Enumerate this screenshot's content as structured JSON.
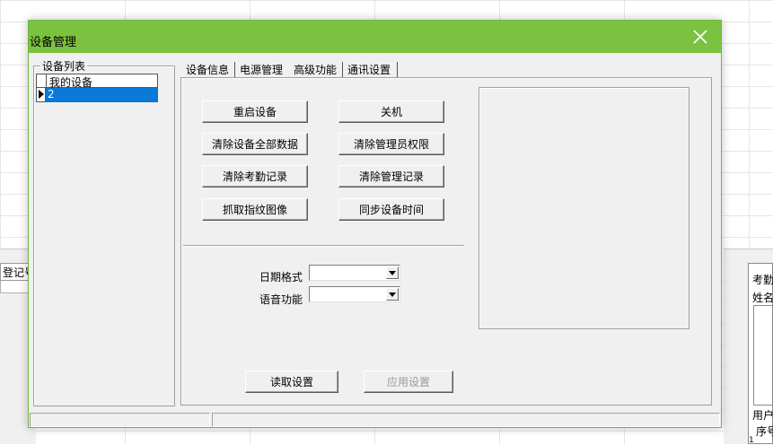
{
  "background": {
    "left_field_text": "登记号",
    "right_texts": [
      "考勤",
      "姓名",
      "用户",
      "序号"
    ],
    "right_number": "1"
  },
  "dialog": {
    "title": "设备管理",
    "close_icon": "close-x-icon",
    "titlebar_color": "#7cc241"
  },
  "device_list": {
    "group_title": "设备列表",
    "header": "我的设备",
    "selected_row": "2",
    "row_indicator_icon": "row-pointer-icon"
  },
  "tabs": [
    "设备信息",
    "电源管理",
    "高级功能",
    "通讯设置"
  ],
  "active_tab": "高级功能",
  "buttons": {
    "restart": "重启设备",
    "shutdown": "关机",
    "clear_all": "清除设备全部数据",
    "clear_admin_rights": "清除管理员权限",
    "clear_attendance": "清除考勤记录",
    "clear_admin_records": "清除管理记录",
    "capture_fingerprint": "抓取指纹图像",
    "sync_time": "同步设备时间",
    "read_settings": "读取设置",
    "apply_settings": "应用设置"
  },
  "settings": {
    "date_format_label": "日期格式",
    "date_format_value": "",
    "voice_label": "语音功能",
    "voice_value": ""
  },
  "selection_color": "#0a78d7"
}
